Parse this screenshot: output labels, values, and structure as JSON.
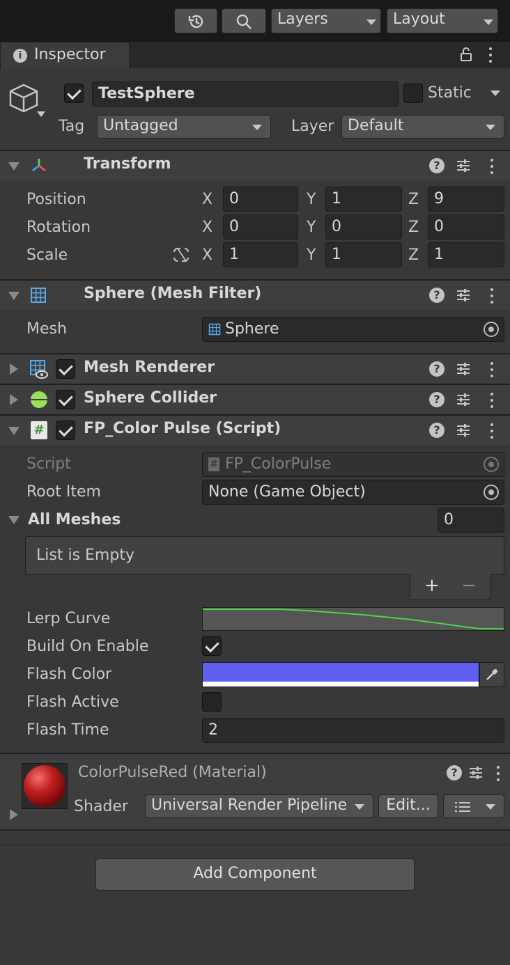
{
  "toolbar": {
    "history_icon": "history-icon",
    "search_icon": "search-icon",
    "layers_label": "Layers",
    "layout_label": "Layout"
  },
  "tab": {
    "title": "Inspector",
    "info_icon": "info-icon",
    "lock_icon": "lock-icon"
  },
  "gameobject": {
    "active": true,
    "name": "TestSphere",
    "static_label": "Static",
    "static_checked": false,
    "tag_label": "Tag",
    "tag_value": "Untagged",
    "layer_label": "Layer",
    "layer_value": "Default"
  },
  "transform": {
    "title": "Transform",
    "position_label": "Position",
    "rotation_label": "Rotation",
    "scale_label": "Scale",
    "axis_x": "X",
    "axis_y": "Y",
    "axis_z": "Z",
    "position": {
      "x": "0",
      "y": "1",
      "z": "9"
    },
    "rotation": {
      "x": "0",
      "y": "0",
      "z": "0"
    },
    "scale": {
      "x": "1",
      "y": "1",
      "z": "1"
    }
  },
  "mesh_filter": {
    "title": "Sphere (Mesh Filter)",
    "mesh_label": "Mesh",
    "mesh_value": "Sphere"
  },
  "mesh_renderer": {
    "title": "Mesh Renderer",
    "enabled": true
  },
  "sphere_collider": {
    "title": "Sphere Collider",
    "enabled": true
  },
  "script_component": {
    "title": "FP_Color Pulse (Script)",
    "enabled": true,
    "script_label": "Script",
    "script_value": "FP_ColorPulse",
    "root_item_label": "Root Item",
    "root_item_value": "None (Game Object)",
    "all_meshes_label": "All Meshes",
    "all_meshes_count": "0",
    "list_empty": "List is Empty",
    "add_symbol": "+",
    "remove_symbol": "−",
    "lerp_curve_label": "Lerp Curve",
    "build_on_enable_label": "Build On Enable",
    "build_on_enable": true,
    "flash_color_label": "Flash Color",
    "flash_color": "#6060f0",
    "flash_active_label": "Flash Active",
    "flash_active": false,
    "flash_time_label": "Flash Time",
    "flash_time": "2"
  },
  "material": {
    "title": "ColorPulseRed (Material)",
    "shader_label": "Shader",
    "shader_value": "Universal Render Pipeline",
    "edit_label": "Edit..."
  },
  "add_component_label": "Add Component"
}
